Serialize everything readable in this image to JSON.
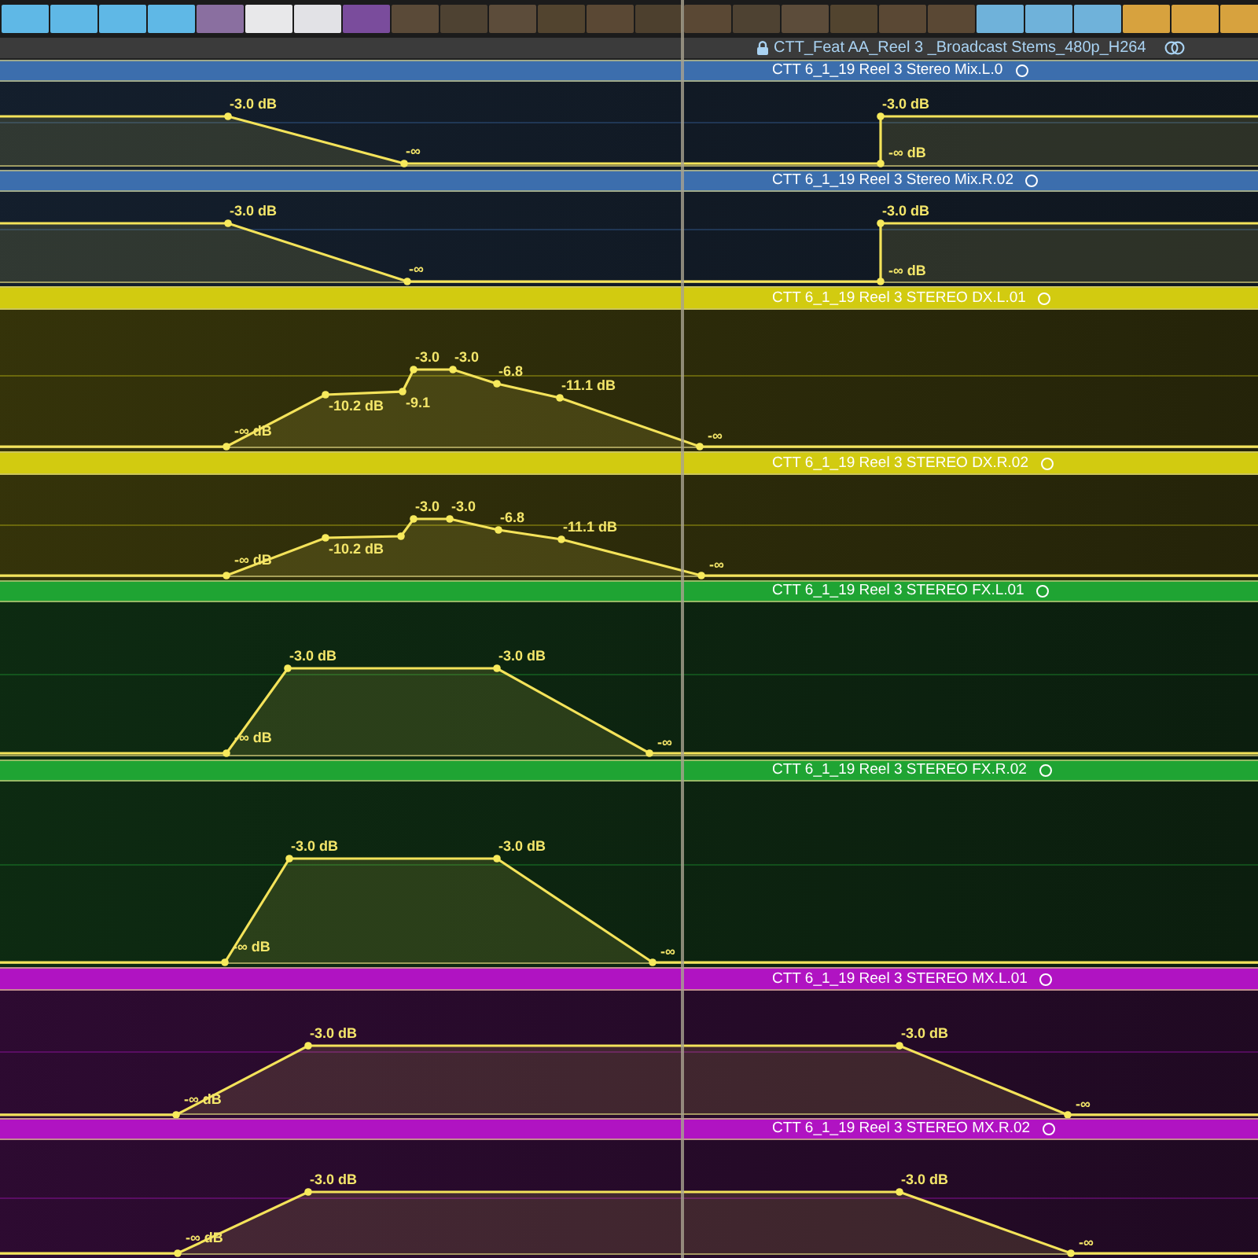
{
  "project_bar": {
    "title": "CTT_Feat AA_Reel 3 _Broadcast Stems_480p_H264"
  },
  "tracks": [
    {
      "name": "CTT 6_1_19 Reel 3 Stereo Mix.L.0",
      "color": "#3c6ead",
      "keyframes": [
        {
          "label": "-3.0 dB"
        },
        {
          "label": "-3.0 dB"
        },
        {
          "label": "-∞"
        },
        {
          "label": "-∞ dB"
        }
      ]
    },
    {
      "name": "CTT 6_1_19 Reel 3 Stereo Mix.R.02",
      "color": "#3c6ead",
      "keyframes": [
        {
          "label": "-3.0 dB"
        },
        {
          "label": "-3.0 dB"
        },
        {
          "label": "-∞"
        },
        {
          "label": "-∞ dB"
        }
      ]
    },
    {
      "name": "CTT 6_1_19 Reel 3 STEREO DX.L.01",
      "color": "#d2cb10",
      "keyframes": [
        {
          "label": "-∞ dB"
        },
        {
          "label": "-10.2 dB"
        },
        {
          "label": "-9.1"
        },
        {
          "label": "-3.0"
        },
        {
          "label": "-3.0"
        },
        {
          "label": "-6.8"
        },
        {
          "label": "-11.1 dB"
        },
        {
          "label": "-∞"
        }
      ]
    },
    {
      "name": "CTT 6_1_19 Reel 3 STEREO DX.R.02",
      "color": "#d2cb10",
      "keyframes": [
        {
          "label": "-∞ dB"
        },
        {
          "label": "-10.2 dB"
        },
        {
          "label": "-3.0"
        },
        {
          "label": "-3.0"
        },
        {
          "label": "-6.8"
        },
        {
          "label": "-11.1 dB"
        },
        {
          "label": "-∞"
        }
      ]
    },
    {
      "name": "CTT 6_1_19 Reel 3 STEREO FX.L.01",
      "color": "#1fa433",
      "keyframes": [
        {
          "label": "-∞ dB"
        },
        {
          "label": "-3.0 dB"
        },
        {
          "label": "-3.0 dB"
        },
        {
          "label": "-∞"
        }
      ]
    },
    {
      "name": "CTT 6_1_19 Reel 3 STEREO FX.R.02",
      "color": "#1fa433",
      "keyframes": [
        {
          "label": "-∞ dB"
        },
        {
          "label": "-3.0 dB"
        },
        {
          "label": "-3.0 dB"
        },
        {
          "label": "-∞"
        }
      ]
    },
    {
      "name": "CTT 6_1_19 Reel 3 STEREO MX.L.01",
      "color": "#b013c2",
      "keyframes": [
        {
          "label": "-∞ dB"
        },
        {
          "label": "-3.0 dB"
        },
        {
          "label": "-3.0 dB"
        },
        {
          "label": "-∞"
        }
      ]
    },
    {
      "name": "CTT 6_1_19 Reel 3 STEREO MX.R.02",
      "color": "#b013c2",
      "keyframes": [
        {
          "label": "-∞ dB"
        },
        {
          "label": "-3.0 dB"
        },
        {
          "label": "-3.0 dB"
        },
        {
          "label": "-∞"
        }
      ]
    }
  ]
}
